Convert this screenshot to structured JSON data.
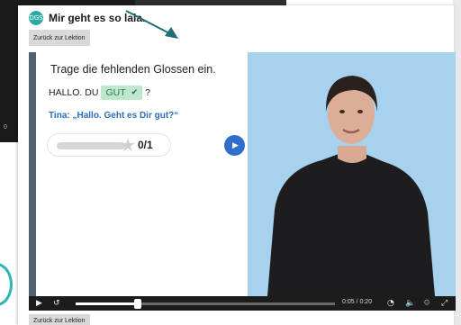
{
  "background": {
    "time_fragment": "0"
  },
  "header": {
    "logo_text": "DGS",
    "title": "Mir geht es so lala.",
    "back_label": "Zurück zur Lektion"
  },
  "exercise": {
    "instruction": "Trage die fehlenden Glossen ein.",
    "gloss_prefix": "HALLO. DU",
    "gloss_answer": "GUT",
    "gloss_suffix": "?",
    "answer_state": "correct",
    "quote": "Tina: „Hallo. Geht es Dir gut?“",
    "score": "0/1",
    "score_progress": 0
  },
  "player": {
    "current_time": "0:05",
    "separator": " / ",
    "duration": "0:20",
    "progress": 0.24,
    "icons": [
      "play-icon",
      "replay-icon",
      "speed-icon",
      "volume-icon",
      "settings-icon",
      "fullscreen-icon"
    ]
  },
  "footer": {
    "back_label": "Zurück zur Lektion"
  },
  "colors": {
    "accent": "#2eaaa6",
    "success_bg": "#bfe6cf",
    "link_blue": "#2b6fb8",
    "play_blue": "#2f6fcb",
    "video_bg": "#a6d2ee",
    "panel_border": "#4e6272"
  }
}
